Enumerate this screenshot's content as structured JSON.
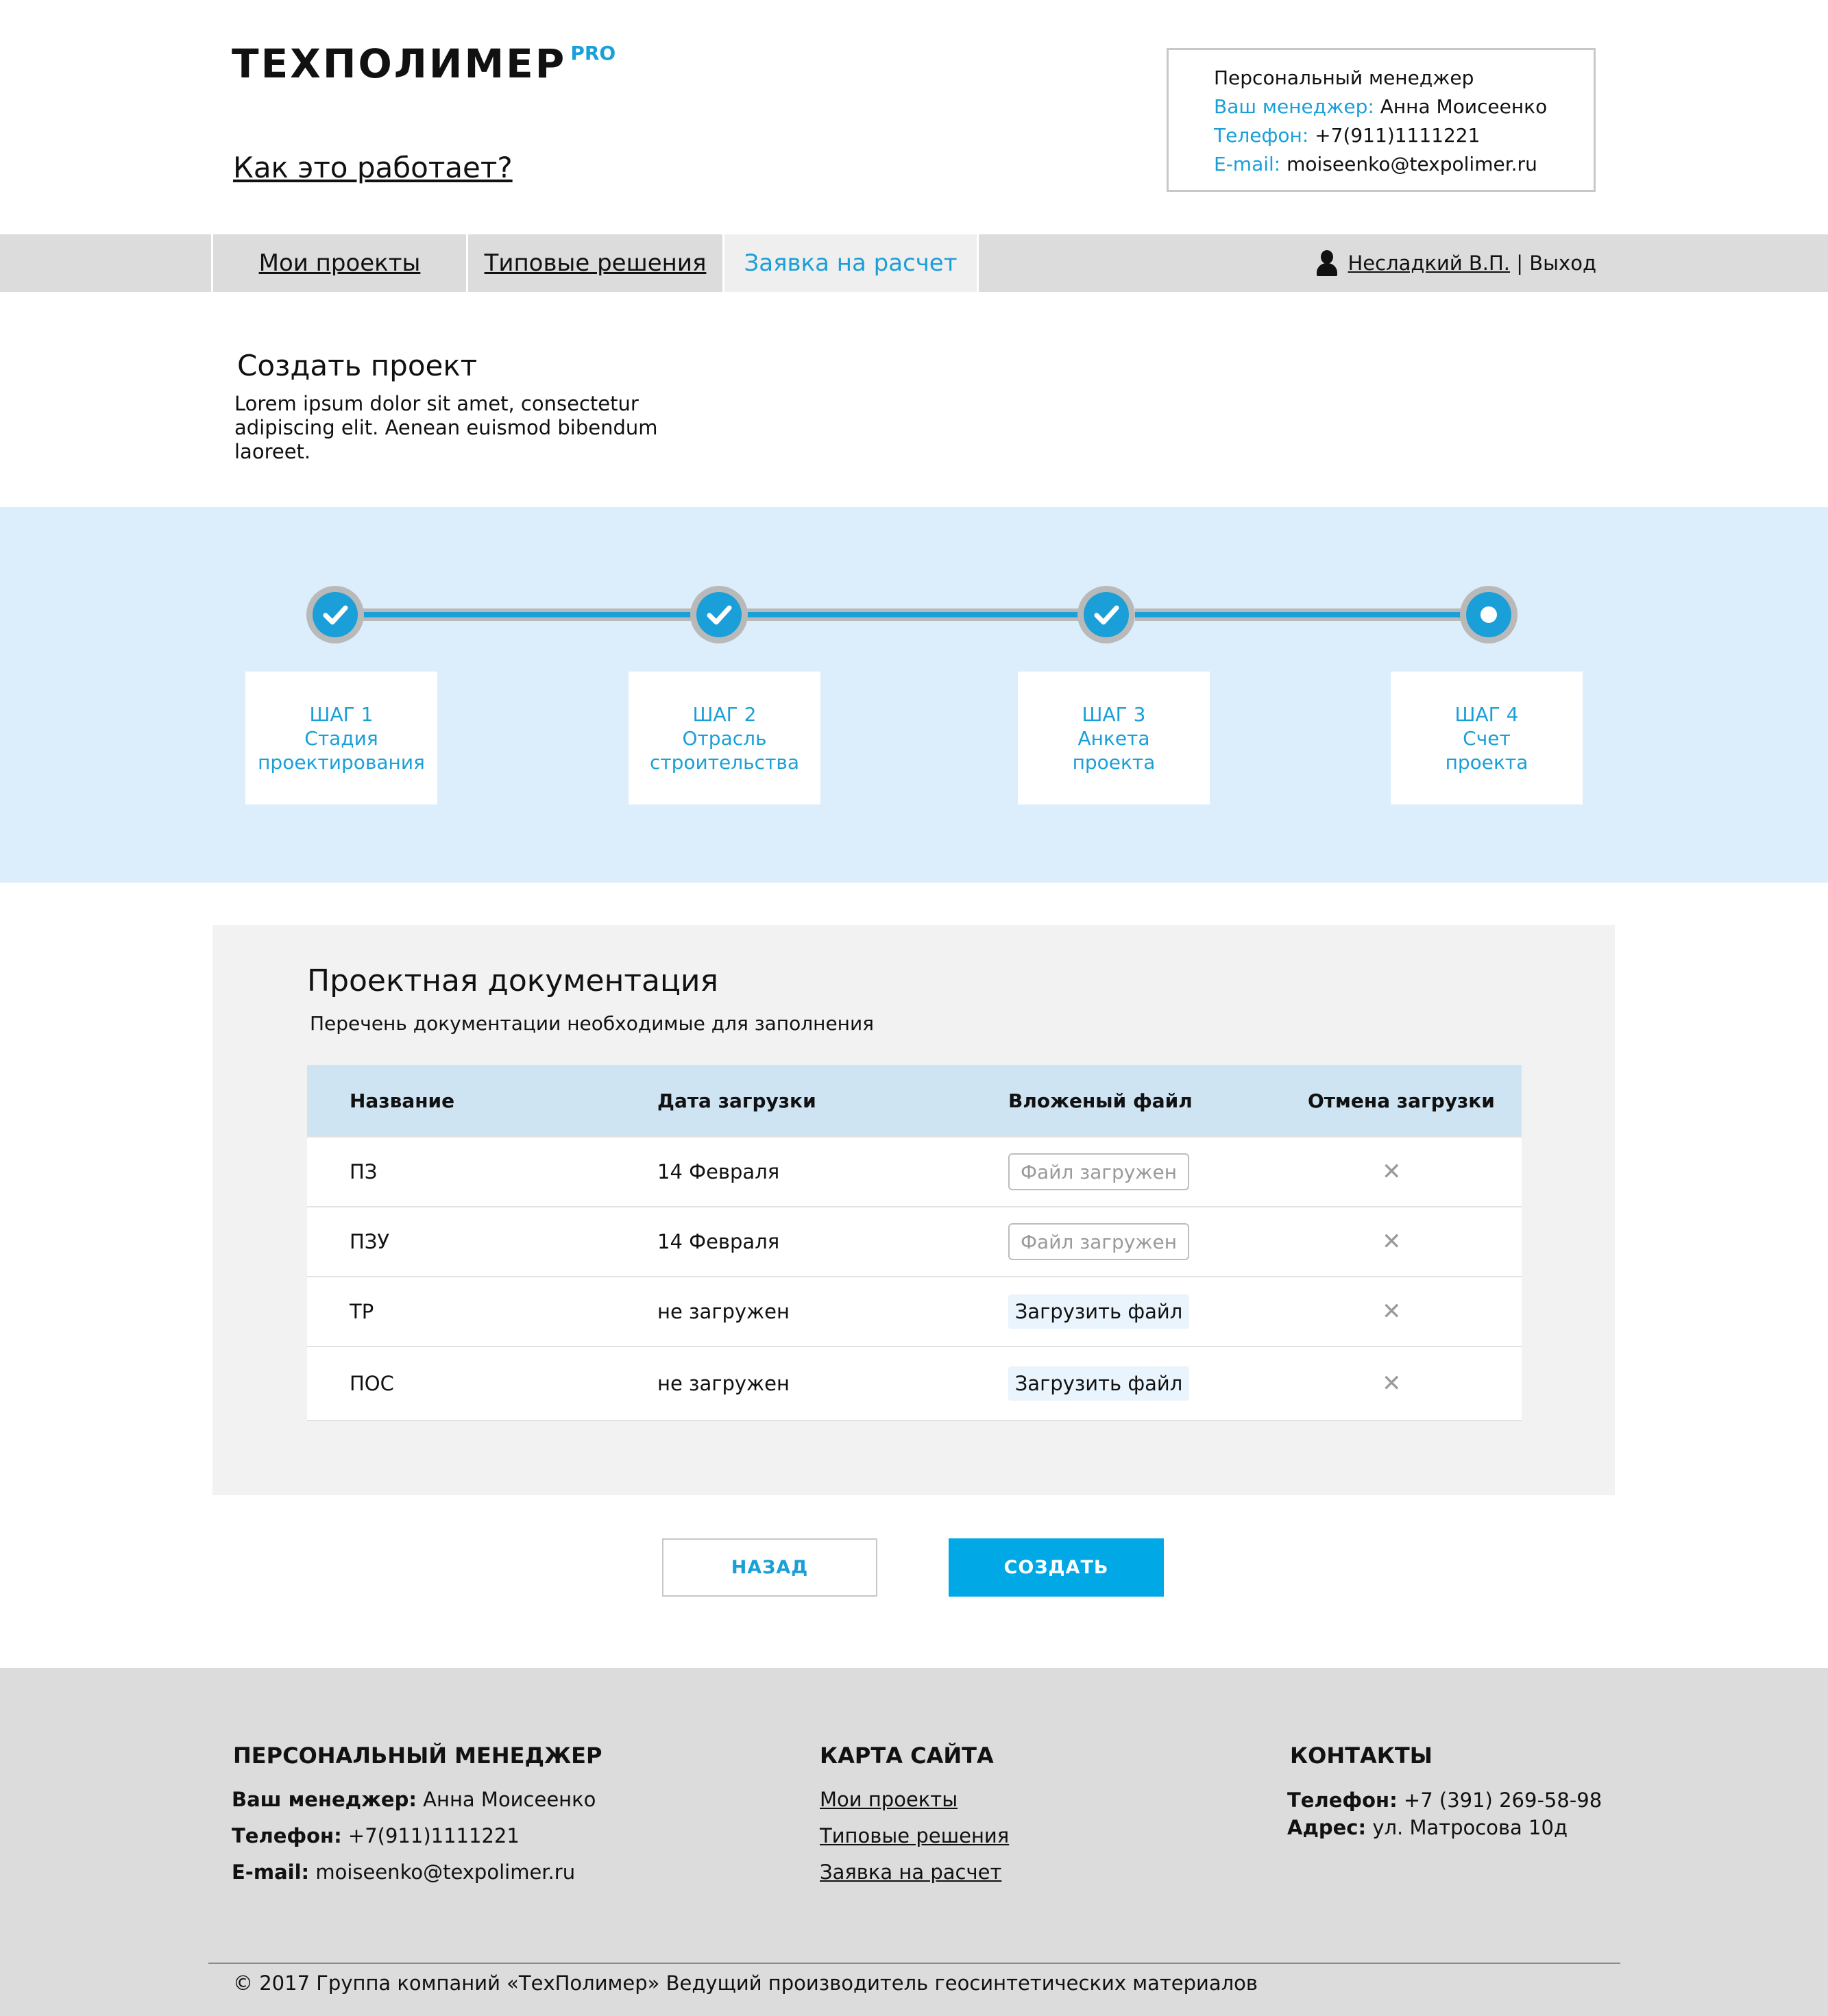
{
  "header": {
    "logo_main": "ТЕХПОЛИМЕР",
    "logo_pro": "PRO",
    "how_it_works": "Как это работает?"
  },
  "manager_box": {
    "title": "Персональный менеджер",
    "manager_label": "Ваш менеджер:",
    "manager_value": "Анна Моисеенко",
    "phone_label": "Телефон:",
    "phone_value": "+7(911)1111221",
    "email_label": "E-mail:",
    "email_value": "moiseenko@texpolimer.ru"
  },
  "nav": {
    "tabs": [
      {
        "label": "Мои проекты"
      },
      {
        "label": "Типовые решения"
      },
      {
        "label": "Заявка на расчет"
      }
    ],
    "user_name": "Несладкий В.П.",
    "separator": " | ",
    "logout": "Выход"
  },
  "create": {
    "title": "Создать проект",
    "description": "Lorem ipsum dolor sit amet, consectetur adipiscing elit. Aenean euismod bibendum laoreet."
  },
  "steps": [
    {
      "line1": "ШАГ 1",
      "line2": "Стадия",
      "line3": "проектирования",
      "status": "done"
    },
    {
      "line1": "ШАГ 2",
      "line2": "Отрасль",
      "line3": "строительства",
      "status": "done"
    },
    {
      "line1": "ШАГ 3",
      "line2": "Анкета",
      "line3": "проекта",
      "status": "done"
    },
    {
      "line1": "ШАГ 4",
      "line2": "Счет",
      "line3": "проекта",
      "status": "current"
    }
  ],
  "docs": {
    "title": "Проектная документация",
    "subtitle": "Перечень документации необходимые для заполнения",
    "columns": [
      "Название",
      "Дата загрузки",
      "Вложеный файл",
      "Отмена загрузки"
    ],
    "rows": [
      {
        "name": "ПЗ",
        "date": "14 Февраля",
        "file": "Файл загружен",
        "file_state": "loaded",
        "cancel": "✕"
      },
      {
        "name": "ПЗУ",
        "date": "14 Февраля",
        "file": "Файл загружен",
        "file_state": "loaded",
        "cancel": "✕"
      },
      {
        "name": "ТР",
        "date": "не загружен",
        "file": "Загрузить файл",
        "file_state": "upload",
        "cancel": "✕"
      },
      {
        "name": "ПОС",
        "date": "не загружен",
        "file": "Загрузить файл",
        "file_state": "upload",
        "cancel": "✕"
      }
    ]
  },
  "buttons": {
    "back": "НАЗАД",
    "create": "СОЗДАТЬ"
  },
  "footer": {
    "manager": {
      "heading": "ПЕРСОНАЛЬНЫЙ МЕНЕДЖЕР",
      "manager_label": "Ваш менеджер:",
      "manager_value": "Анна Моисеенко",
      "phone_label": "Телефон:",
      "phone_value": "+7(911)1111221",
      "email_label": "E-mail:",
      "email_value": "moiseenko@texpolimer.ru"
    },
    "sitemap": {
      "heading": "КАРТА САЙТА",
      "links": [
        "Мои проекты",
        "Типовые решения",
        "Заявка на расчет"
      ]
    },
    "contacts": {
      "heading": "КОНТАКТЫ",
      "phone_label": "Телефон:",
      "phone_value": "+7 (391) 269-58-98",
      "address_label": "Адрес:",
      "address_value": "ул. Матросова 10д"
    },
    "copyright": "© 2017 Группа компаний «ТехПолимер» Ведущий производитель геосинтетических материалов"
  },
  "colors": {
    "accent": "#1a9fd8",
    "button": "#00a8e6",
    "steps_band": "#dcedfb",
    "table_header": "#cfe4f2"
  }
}
